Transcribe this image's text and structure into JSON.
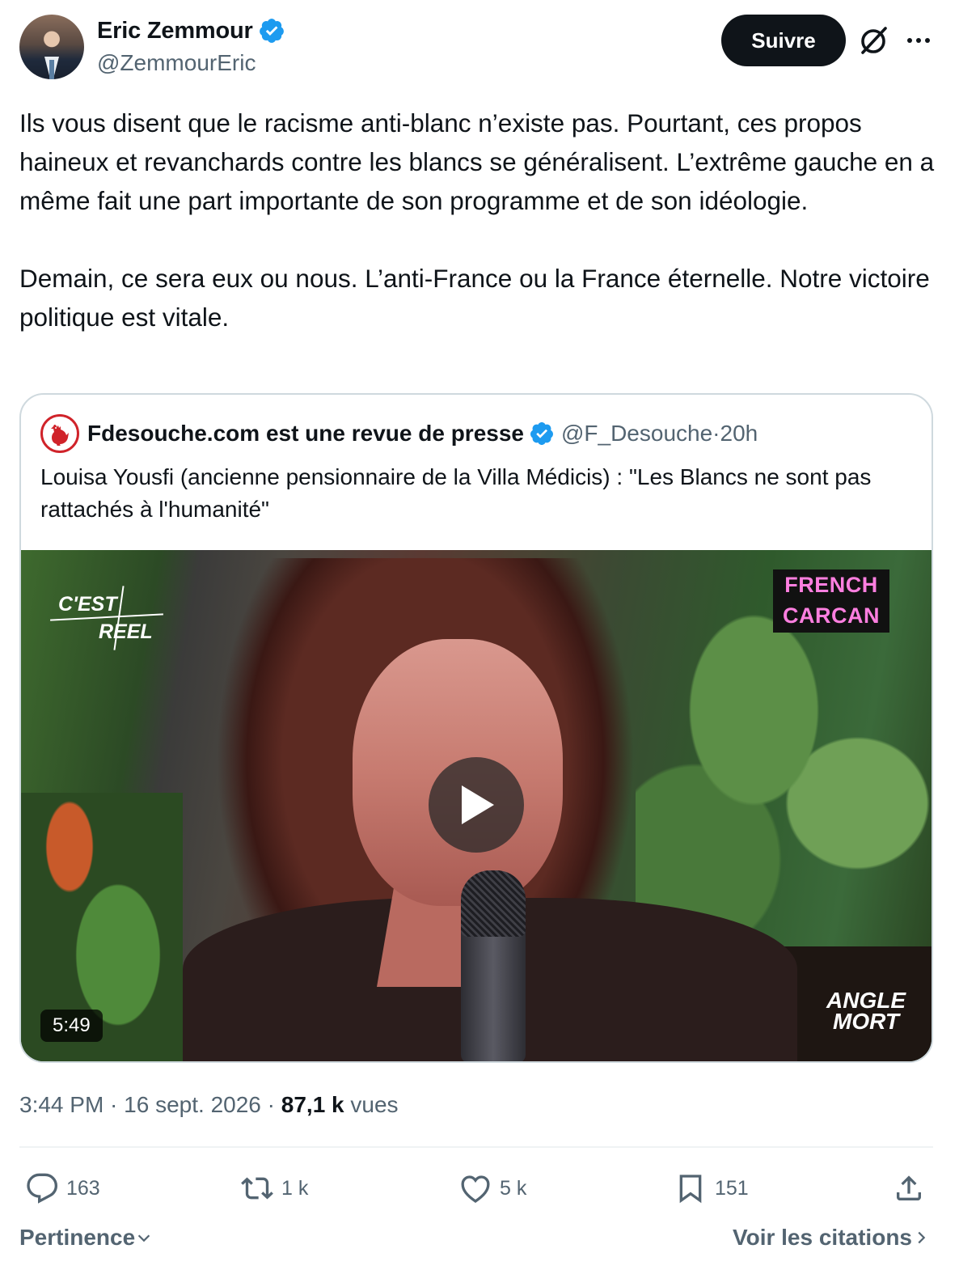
{
  "author": {
    "name": "Eric Zemmour",
    "handle": "@ZemmourEric",
    "avatar_icon": "person-avatar"
  },
  "header": {
    "follow_label": "Suivre",
    "grok_icon": "grok-icon",
    "more_icon": "more-icon"
  },
  "tweet": {
    "text": "Ils vous disent que le racisme anti-blanc n’existe pas. Pourtant, ces propos haineux et revanchards contre les blancs se généralisent. L’extrême gauche en a même fait une part importante de son programme et de son idéologie.\n\nDemain, ce sera eux ou nous. L’anti-France ou la France éternelle. Notre victoire politique est vitale."
  },
  "quote": {
    "name": "Fdesouche.com est une revue de presse",
    "handle": "@F_Desouche",
    "separator": " · ",
    "time": "20h",
    "text": "Louisa Yousfi (ancienne pensionnaire de la Villa Médicis)  : \"Les Blancs ne sont pas rattachés à l'humanité\"",
    "video": {
      "duration": "5:49",
      "logo_cest_line1": "C'EST",
      "logo_cest_line2": "REEL",
      "logo_french_line1": "FRENCH",
      "logo_french_line2": "CARCAN",
      "logo_angle_line1": "ANGLE",
      "logo_angle_line2": "MORT"
    }
  },
  "meta": {
    "time": "3:44 PM",
    "sep1": " · ",
    "date": "16 sept. 2026",
    "sep2": " · ",
    "views_count": "87,1 k",
    "views_label": " vues"
  },
  "actions": {
    "replies": "163",
    "reposts": "1 k",
    "likes": "5 k",
    "bookmarks": "151"
  },
  "footer": {
    "sort_label": "Pertinence",
    "quotes_label": "Voir les citations"
  },
  "colors": {
    "verified": "#1d9bf0",
    "text": "#0f1419",
    "secondary": "#536471",
    "border": "#cfd9de",
    "french_carcan": "#ff7fe0"
  }
}
